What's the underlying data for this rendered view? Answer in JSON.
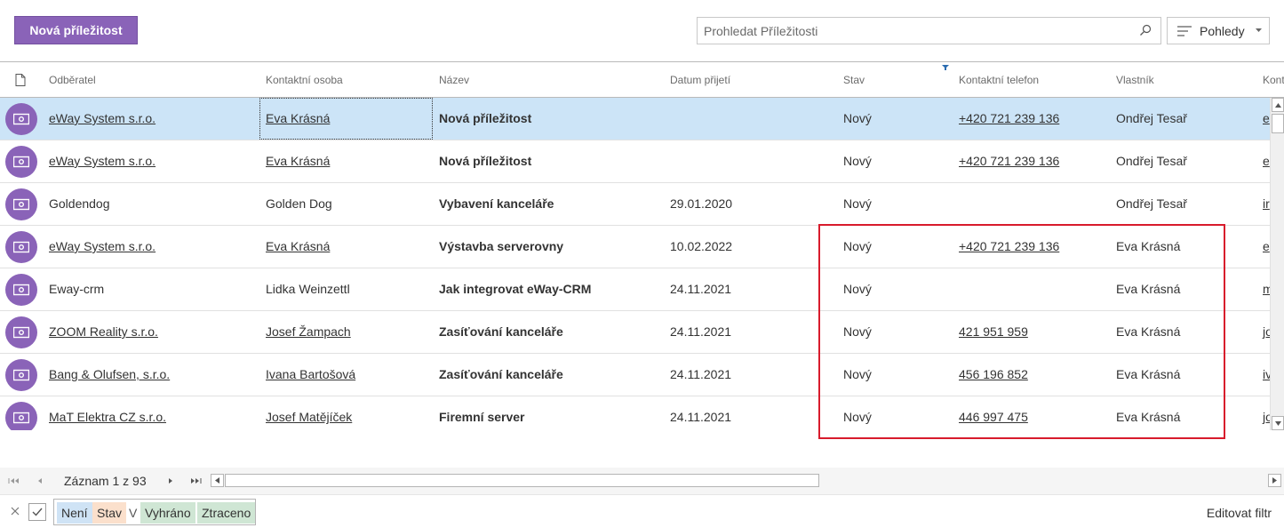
{
  "toolbar": {
    "new_button_label": "Nová příležitost",
    "search_placeholder": "Prohledat Příležitosti",
    "views_label": "Pohledy"
  },
  "columns": {
    "customer": "Odběratel",
    "contact": "Kontaktní osoba",
    "name": "Název",
    "date": "Datum přijetí",
    "state": "Stav",
    "phone": "Kontaktní telefon",
    "owner": "Vlastník",
    "more": "Kont"
  },
  "rows": [
    {
      "customer": "eWay System s.r.o.",
      "contact": "Eva Krásná",
      "name": "Nová příležitost",
      "date": "",
      "state": "Nový",
      "phone": "+420 721 239 136",
      "owner": "Ondřej Tesař",
      "more": "e"
    },
    {
      "customer": "eWay System s.r.o.",
      "contact": "Eva Krásná",
      "name": "Nová příležitost",
      "date": "",
      "state": "Nový",
      "phone": "+420 721 239 136",
      "owner": "Ondřej Tesař",
      "more": "e"
    },
    {
      "customer": "Goldendog",
      "contact": "Golden Dog",
      "name": "Vybavení kanceláře",
      "date": "29.01.2020",
      "state": "Nový",
      "phone": "",
      "owner": "Ondřej Tesař",
      "more": "ir"
    },
    {
      "customer": "eWay System s.r.o.",
      "contact": "Eva Krásná",
      "name": "Výstavba serverovny",
      "date": "10.02.2022",
      "state": "Nový",
      "phone": "+420 721 239 136",
      "owner": "Eva Krásná",
      "more": "e"
    },
    {
      "customer": "Eway-crm",
      "contact": "Lidka Weinzettl",
      "name": "Jak integrovat eWay-CRM",
      "date": "24.11.2021",
      "state": "Nový",
      "phone": "",
      "owner": "Eva Krásná",
      "more": "m"
    },
    {
      "customer": "ZOOM Reality s.r.o.",
      "contact": "Josef Žampach",
      "name": "Zasíťování kanceláře",
      "date": "24.11.2021",
      "state": "Nový",
      "phone": "421 951 959",
      "owner": "Eva Krásná",
      "more": "jo"
    },
    {
      "customer": "Bang & Olufsen, s.r.o.",
      "contact": "Ivana Bartošová",
      "name": "Zasíťování kanceláře",
      "date": "24.11.2021",
      "state": "Nový",
      "phone": "456 196 852",
      "owner": "Eva Krásná",
      "more": "iv"
    },
    {
      "customer": "MaT Elektra CZ s.r.o.",
      "contact": "Josef Matějíček",
      "name": "Firemní server",
      "date": "24.11.2021",
      "state": "Nový",
      "phone": "446 997 475",
      "owner": "Eva Krásná",
      "more": "jo"
    }
  ],
  "pager": {
    "record_text": "Záznam 1 z 93"
  },
  "filter": {
    "chip_not": "Není",
    "chip_state": "Stav",
    "chip_in": "V",
    "chip_won": "Vyhráno",
    "chip_lost": "Ztraceno",
    "edit_label": "Editovat filtr"
  },
  "colors": {
    "accent": "#8a63b8",
    "selected_row": "#cce4f7",
    "highlight": "#d81b2c"
  }
}
